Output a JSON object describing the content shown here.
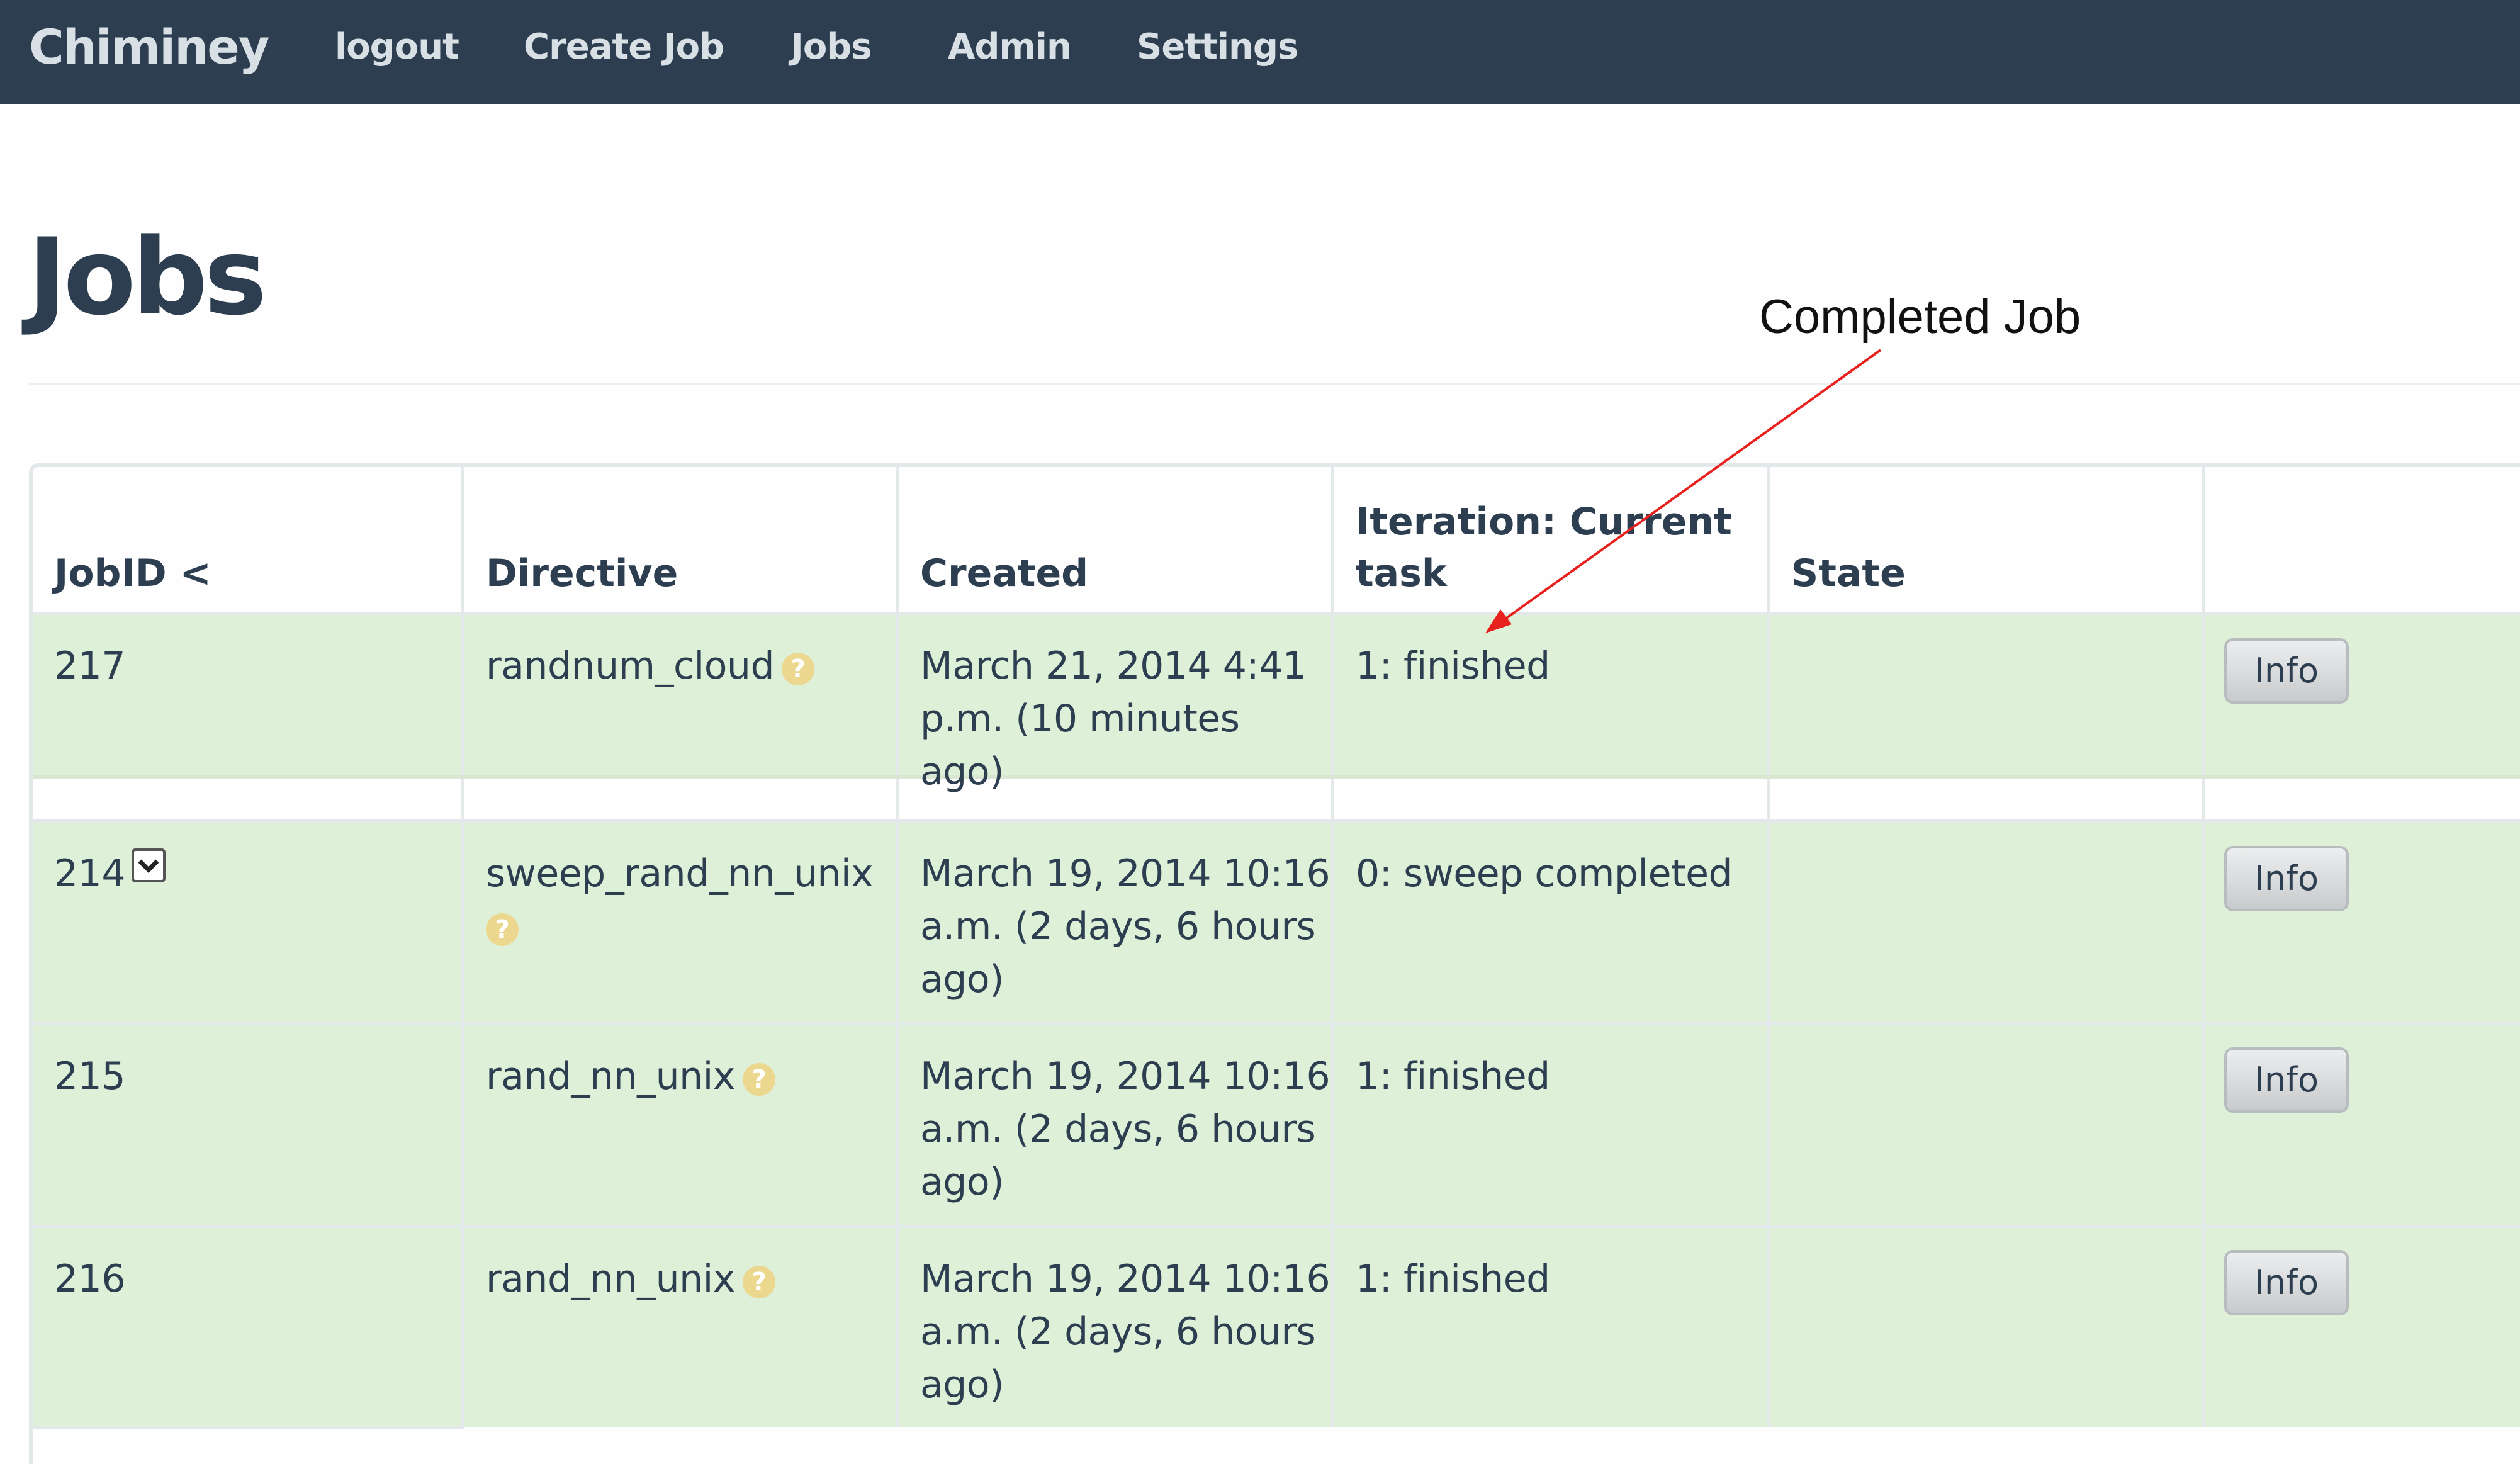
{
  "navbar": {
    "brand": "Chiminey",
    "links": [
      "logout",
      "Create Job",
      "Jobs",
      "Admin",
      "Settings"
    ]
  },
  "page": {
    "title": "Jobs"
  },
  "annotation": {
    "label": "Completed Job",
    "arrow_color": "#e8211e"
  },
  "table": {
    "headers": {
      "jobid": "JobID <",
      "directive": "Directive",
      "created": "Created",
      "iteration_line1": "Iteration: Current",
      "iteration_line2": "task",
      "state": "State"
    },
    "rows": [
      {
        "jobid": "217",
        "directive": "randnum_cloud",
        "created_line1": "March 21, 2014 4:41",
        "created_line2": "p.m. (10 minutes ago)",
        "created_line3": "",
        "iteration": "1: finished",
        "state": "",
        "action": "Info"
      },
      {
        "jobid": "214",
        "directive": "sweep_rand_nn_unix",
        "created_line1": "March 19, 2014 10:16",
        "created_line2": "a.m. (2 days, 6 hours",
        "created_line3": "ago)",
        "iteration": "0: sweep completed",
        "state": "",
        "action": "Info"
      },
      {
        "jobid": "215",
        "directive": "rand_nn_unix",
        "created_line1": "March 19, 2014 10:16",
        "created_line2": "a.m. (2 days, 6 hours",
        "created_line3": "ago)",
        "iteration": "1: finished",
        "state": "",
        "action": "Info"
      },
      {
        "jobid": "216",
        "directive": "rand_nn_unix",
        "created_line1": "March 19, 2014 10:16",
        "created_line2": "a.m. (2 days, 6 hours",
        "created_line3": "ago)",
        "iteration": "1: finished",
        "state": "",
        "action": "Info"
      }
    ],
    "help_icon_glyph": "?",
    "colors": {
      "row_success": "#dff0d8",
      "navbar": "#2c3e50",
      "help_icon": "#ecd78e"
    }
  }
}
